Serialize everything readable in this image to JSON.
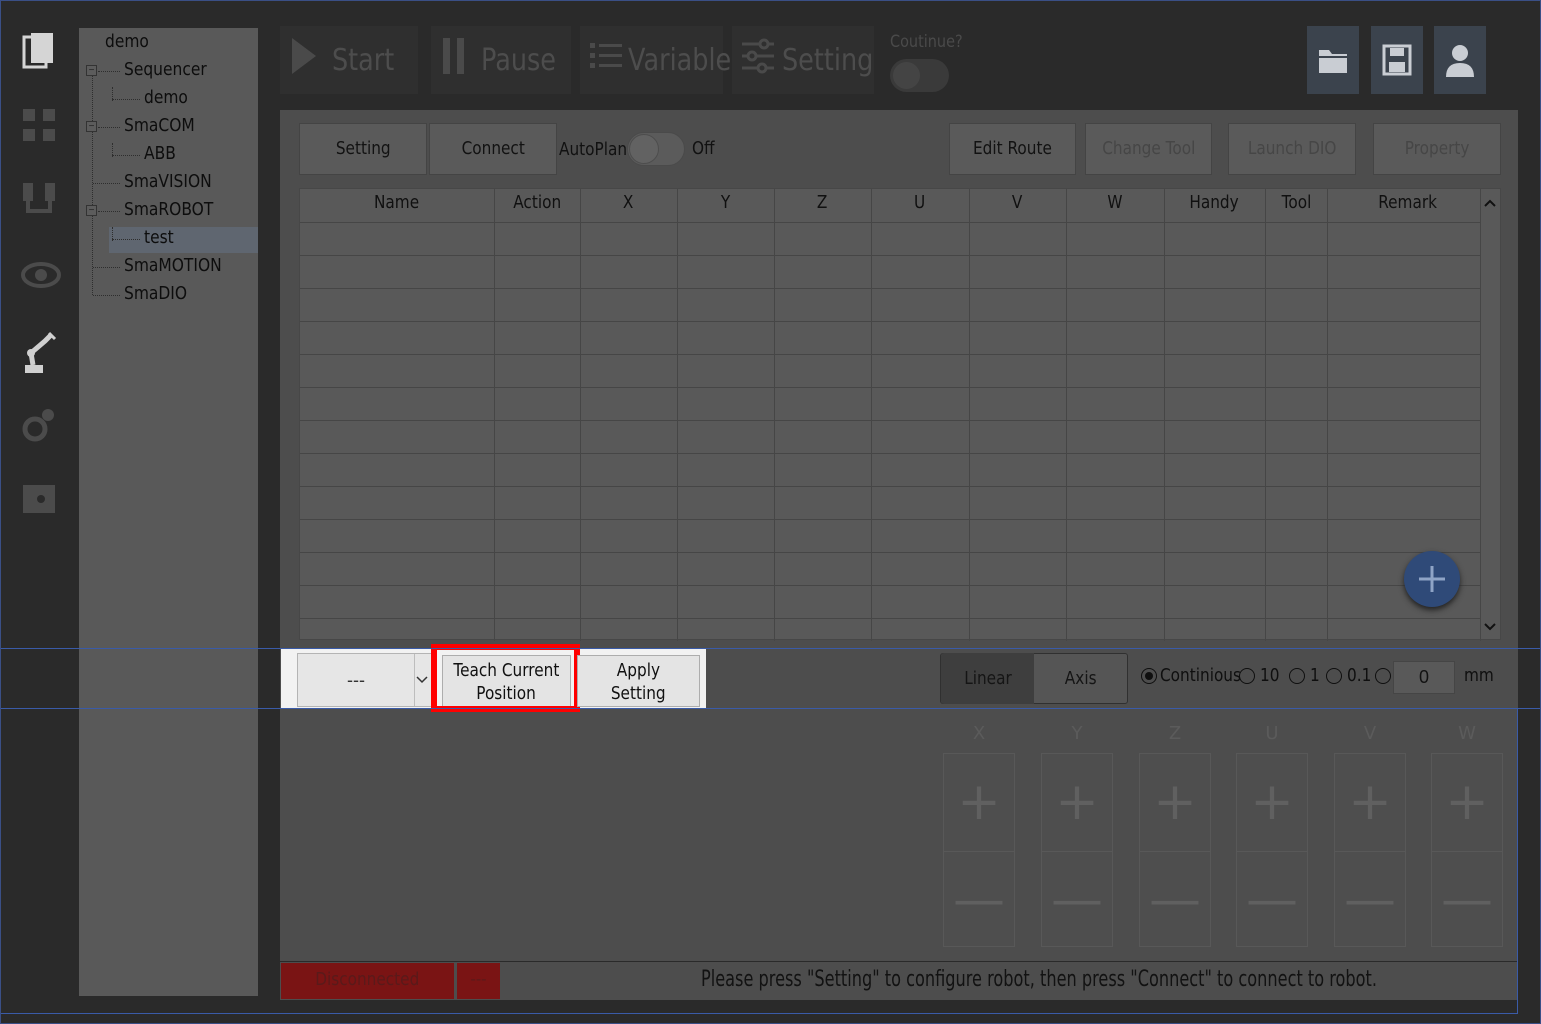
{
  "toolbar": {
    "start": "Start",
    "pause": "Pause",
    "variable": "Variable",
    "setting": "Setting",
    "continue_label": "Coutinue?"
  },
  "tree": {
    "root": "demo",
    "nodes": [
      "Sequencer",
      "demo",
      "SmaCOM",
      "ABB",
      "SmaVISION",
      "SmaROBOT",
      "test",
      "SmaMOTION",
      "SmaDIO"
    ]
  },
  "panel": {
    "setting_btn": "Setting",
    "connect_btn": "Connect",
    "autoplan_label": "AutoPlan",
    "autoplan_state": "Off",
    "edit_route": "Edit Route",
    "change_tool": "Change Tool",
    "launch_dio": "Launch DIO",
    "property": "Property"
  },
  "table": {
    "columns": [
      "Name",
      "Action",
      "X",
      "Y",
      "Z",
      "U",
      "V",
      "W",
      "Handy",
      "Tool",
      "Remark"
    ],
    "rows": []
  },
  "bottom": {
    "point_select": "---",
    "teach_line1": "Teach Current",
    "teach_line2": "Position",
    "apply_line1": "Apply",
    "apply_line2": "Setting",
    "linear": "Linear",
    "axis": "Axis",
    "step_options": [
      "Continious",
      "10",
      "1",
      "0.1"
    ],
    "step_selected": "Continious",
    "step_value": "0",
    "unit": "mm"
  },
  "jog": {
    "axes": [
      "X",
      "Y",
      "Z",
      "U",
      "V",
      "W"
    ],
    "plus": "+",
    "minus": "—"
  },
  "status": {
    "connection": "Disconnected",
    "code": "---",
    "message": "Please press \"Setting\" to configure robot, then press \"Connect\" to connect to robot."
  },
  "colors": {
    "highlight": "#ff0000",
    "status_error": "#7a1414"
  }
}
